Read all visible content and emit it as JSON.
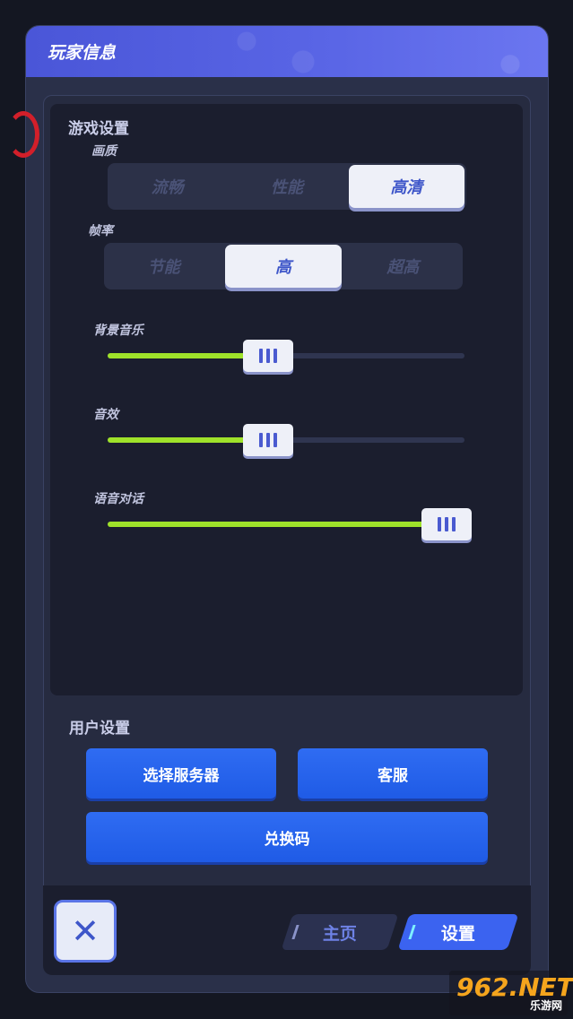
{
  "header": {
    "title": "玩家信息"
  },
  "game_settings": {
    "section_title": "游戏设置",
    "quality": {
      "label": "画质",
      "options": [
        "流畅",
        "性能",
        "高清"
      ],
      "selected": "高清"
    },
    "framerate": {
      "label": "帧率",
      "options": [
        "节能",
        "高",
        "超高"
      ],
      "selected": "高"
    },
    "sliders": [
      {
        "label": "背景音乐",
        "value": 0.45
      },
      {
        "label": "音效",
        "value": 0.45
      },
      {
        "label": "语音对话",
        "value": 0.95
      }
    ]
  },
  "user_settings": {
    "section_title": "用户设置",
    "select_server": "选择服务器",
    "customer_service": "客服",
    "redeem_code": "兑换码"
  },
  "footer": {
    "close_icon": "✕",
    "tabs": [
      {
        "label": "主页",
        "active": false
      },
      {
        "label": "设置",
        "active": true
      }
    ]
  },
  "watermark": {
    "big": "962.NET",
    "small": "乐游网"
  },
  "colors": {
    "accent": "#2f6cf2",
    "slider_fill": "#9fe22a",
    "header": "#4a56d8"
  }
}
